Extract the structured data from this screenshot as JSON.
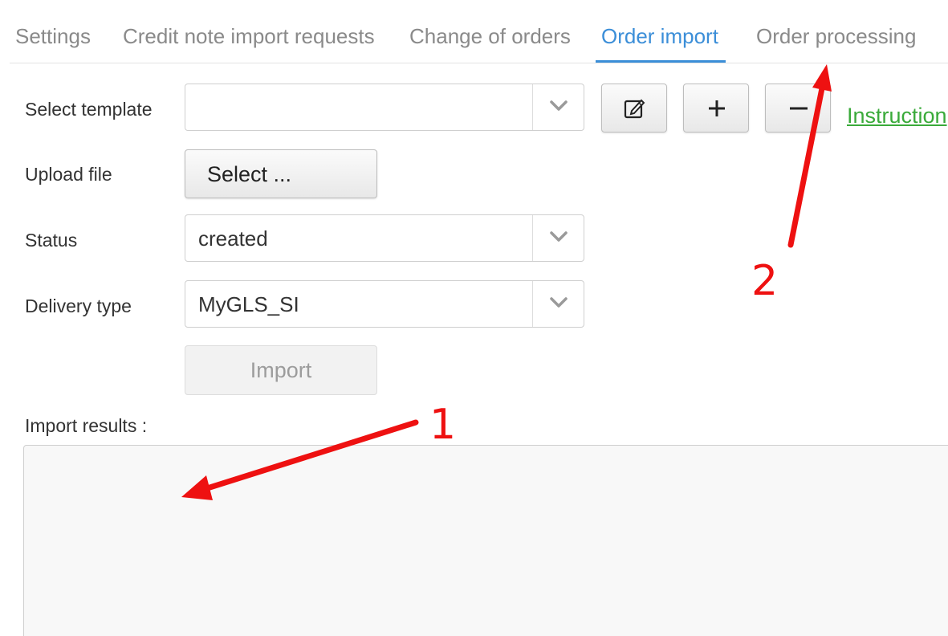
{
  "tabs": [
    {
      "label": "Settings",
      "active": false
    },
    {
      "label": "Credit note import requests",
      "active": false
    },
    {
      "label": "Change of orders",
      "active": false
    },
    {
      "label": "Order import",
      "active": true
    },
    {
      "label": "Order processing",
      "active": false
    }
  ],
  "form": {
    "template_label": "Select template",
    "template_value": "",
    "upload_label": "Upload file",
    "select_button_label": "Select ...",
    "status_label": "Status",
    "status_value": "created",
    "delivery_label": "Delivery type",
    "delivery_value": "MyGLS_SI",
    "import_button_label": "Import",
    "instructions_link": "Instruction",
    "results_label": "Import results :"
  },
  "icons": {
    "edit": "edit-icon",
    "add": "plus-icon",
    "remove": "minus-icon",
    "dropdown": "chevron-down-icon"
  },
  "annotations": {
    "marker_1": "1",
    "marker_2": "2",
    "color": "#ee1111"
  },
  "colors": {
    "accent": "#3b8ed8",
    "link": "#3aaa3a",
    "tab_inactive": "#8a8a8a"
  }
}
